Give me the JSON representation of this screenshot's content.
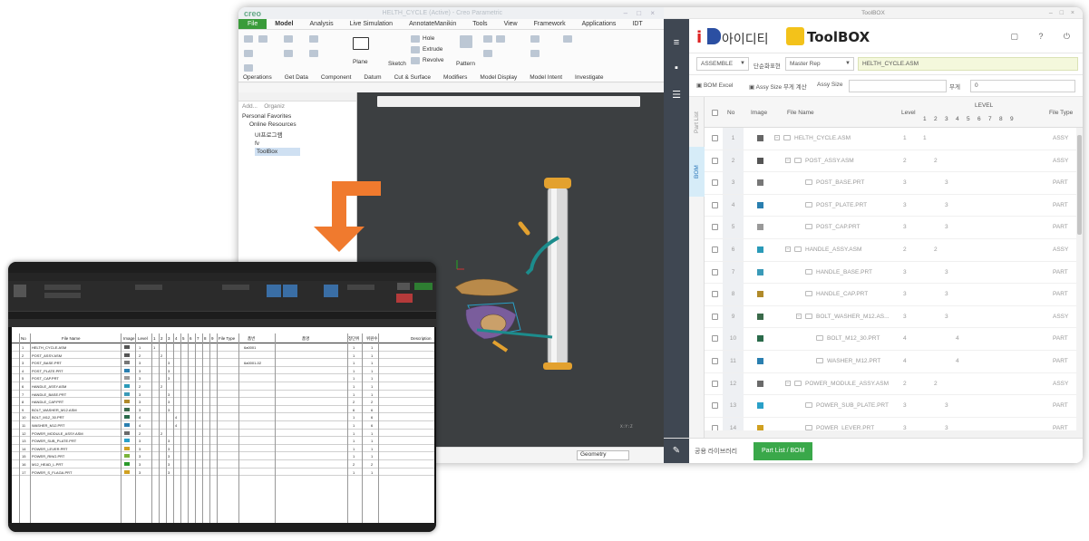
{
  "creo": {
    "logo": "creo",
    "title": "HELTH_CYCLE (Active) - Creo Parametric",
    "tabs": [
      "File",
      "Model",
      "Analysis",
      "Live Simulation",
      "AnnotateManikin",
      "Tools",
      "View",
      "Framework",
      "Applications",
      "IDT"
    ],
    "ribbon_items": [
      "Hole",
      "Extrude",
      "Revolve",
      "Sketch",
      "Plane",
      "Pattern"
    ],
    "groups": [
      "Operations",
      "Get Data",
      "Component",
      "Datum",
      "Cut & Surface",
      "Modifiers",
      "Model Display",
      "Model Intent",
      "Investigate"
    ],
    "tree": {
      "tabs": [
        "Add...",
        "Organiz"
      ],
      "items": [
        "Personal Favorites",
        "Online Resources",
        "UI프로그램",
        "fv",
        "ToolBox"
      ]
    },
    "status": {
      "geometry": "Geometry"
    }
  },
  "toolbox": {
    "window_title": "ToolBOX",
    "logo_text": "아이디티",
    "logo_brand": "ToolBOX",
    "filter": {
      "mode": "ASSEMBLE",
      "rep_label": "단순화표현",
      "rep_value": "Master Rep",
      "asm_name": "HELTH_CYCLE.ASM"
    },
    "actions": {
      "bom_excel": "BOM Excel",
      "assy_size": "Assy Size 무게 계산",
      "assy_size_label": "Assy Size",
      "weight_label": "무게",
      "weight_value": "0"
    },
    "vtabs": [
      "Part List",
      "BOM"
    ],
    "columns": {
      "no": "No",
      "image": "Image",
      "file_name": "File Name",
      "level": "Level",
      "level_group": "LEVEL",
      "levels": [
        "1",
        "2",
        "3",
        "4",
        "5",
        "6",
        "7",
        "8",
        "9"
      ],
      "file_type": "File Type"
    },
    "rows": [
      {
        "no": "1",
        "name": "HELTH_CYCLE.ASM",
        "level": "1",
        "lvcol": "1",
        "type": "ASSY"
      },
      {
        "no": "2",
        "name": "POST_ASSY.ASM",
        "level": "2",
        "lvcol": "2",
        "type": "ASSY"
      },
      {
        "no": "3",
        "name": "POST_BASE.PRT",
        "level": "3",
        "lvcol": "3",
        "type": "PART"
      },
      {
        "no": "4",
        "name": "POST_PLATE.PRT",
        "level": "3",
        "lvcol": "3",
        "type": "PART"
      },
      {
        "no": "5",
        "name": "POST_CAP.PRT",
        "level": "3",
        "lvcol": "3",
        "type": "PART"
      },
      {
        "no": "6",
        "name": "HANDLE_ASSY.ASM",
        "level": "2",
        "lvcol": "2",
        "type": "ASSY"
      },
      {
        "no": "7",
        "name": "HANDLE_BASE.PRT",
        "level": "3",
        "lvcol": "3",
        "type": "PART"
      },
      {
        "no": "8",
        "name": "HANDLE_CAP.PRT",
        "level": "3",
        "lvcol": "3",
        "type": "PART"
      },
      {
        "no": "9",
        "name": "BOLT_WASHER_M12.AS...",
        "level": "3",
        "lvcol": "3",
        "type": "ASSY"
      },
      {
        "no": "10",
        "name": "BOLT_M12_30.PRT",
        "level": "4",
        "lvcol": "4",
        "type": "PART"
      },
      {
        "no": "11",
        "name": "WASHER_M12.PRT",
        "level": "4",
        "lvcol": "4",
        "type": "PART"
      },
      {
        "no": "12",
        "name": "POWER_MODULE_ASSY.ASM",
        "level": "2",
        "lvcol": "2",
        "type": "ASSY"
      },
      {
        "no": "13",
        "name": "POWER_SUB_PLATE.PRT",
        "level": "3",
        "lvcol": "3",
        "type": "PART"
      },
      {
        "no": "14",
        "name": "POWER_LEVER.PRT",
        "level": "3",
        "lvcol": "3",
        "type": "PART"
      }
    ],
    "bottom_tabs": [
      "공용 라이브러리",
      "Part List / BOM"
    ]
  },
  "excel": {
    "headers": [
      "No",
      "File Name",
      "Image",
      "Level",
      "1",
      "2",
      "3",
      "4",
      "5",
      "6",
      "7",
      "8",
      "9",
      "File Type",
      "품번",
      "품명",
      "정단위",
      "위원수",
      "Description"
    ],
    "rows": [
      {
        "no": "1",
        "name": "HELTH_CYCLE.ASM",
        "level": "1",
        "code": "6a0001",
        "q1": "1",
        "q2": "1"
      },
      {
        "no": "2",
        "name": "POST_ASSY.ASM",
        "level": "2",
        "code": "",
        "q1": "1",
        "q2": "1"
      },
      {
        "no": "3",
        "name": "POST_BASE.PRT",
        "level": "3",
        "code": "6a0001-02",
        "q1": "1",
        "q2": "1"
      },
      {
        "no": "4",
        "name": "POST_PLATE.PRT",
        "level": "3",
        "code": "",
        "q1": "1",
        "q2": "1"
      },
      {
        "no": "5",
        "name": "POST_CAP.PRT",
        "level": "3",
        "code": "",
        "q1": "1",
        "q2": "1"
      },
      {
        "no": "6",
        "name": "HANDLE_ASSY.ASM",
        "level": "2",
        "code": "",
        "q1": "1",
        "q2": "1"
      },
      {
        "no": "7",
        "name": "HANDLE_BASE.PRT",
        "level": "3",
        "code": "",
        "q1": "1",
        "q2": "1"
      },
      {
        "no": "8",
        "name": "HANDLE_CAP.PRT",
        "level": "3",
        "code": "",
        "q1": "2",
        "q2": "2"
      },
      {
        "no": "9",
        "name": "BOLT_WASHER_M12.ASM",
        "level": "3",
        "code": "",
        "q1": "6",
        "q2": "6"
      },
      {
        "no": "10",
        "name": "BOLT_M12_30.PRT",
        "level": "4",
        "code": "",
        "q1": "1",
        "q2": "6"
      },
      {
        "no": "11",
        "name": "WASHER_M12.PRT",
        "level": "4",
        "code": "",
        "q1": "1",
        "q2": "6"
      },
      {
        "no": "12",
        "name": "POWER_MODULE_ASSY.ASM",
        "level": "2",
        "code": "",
        "q1": "1",
        "q2": "1"
      },
      {
        "no": "13",
        "name": "POWER_SUB_PLATE.PRT",
        "level": "3",
        "code": "",
        "q1": "1",
        "q2": "1"
      },
      {
        "no": "14",
        "name": "POWER_LEVER.PRT",
        "level": "3",
        "code": "",
        "q1": "1",
        "q2": "1"
      },
      {
        "no": "15",
        "name": "POWER_RING.PRT",
        "level": "3",
        "code": "",
        "q1": "1",
        "q2": "1"
      },
      {
        "no": "16",
        "name": "M12_HEAD_L.PRT",
        "level": "3",
        "code": "",
        "q1": "2",
        "q2": "2"
      },
      {
        "no": "17",
        "name": "POWER_S_FLAGA.PRT",
        "level": "3",
        "code": "",
        "q1": "1",
        "q2": "1"
      }
    ]
  },
  "colors": {
    "toolbox_sidebar": "#3f4752",
    "accent_green": "#3aa84a",
    "creo_file_tab": "#3a9b3a",
    "arrow": "#f07a2e",
    "asm_field": "#f4f8dc"
  }
}
